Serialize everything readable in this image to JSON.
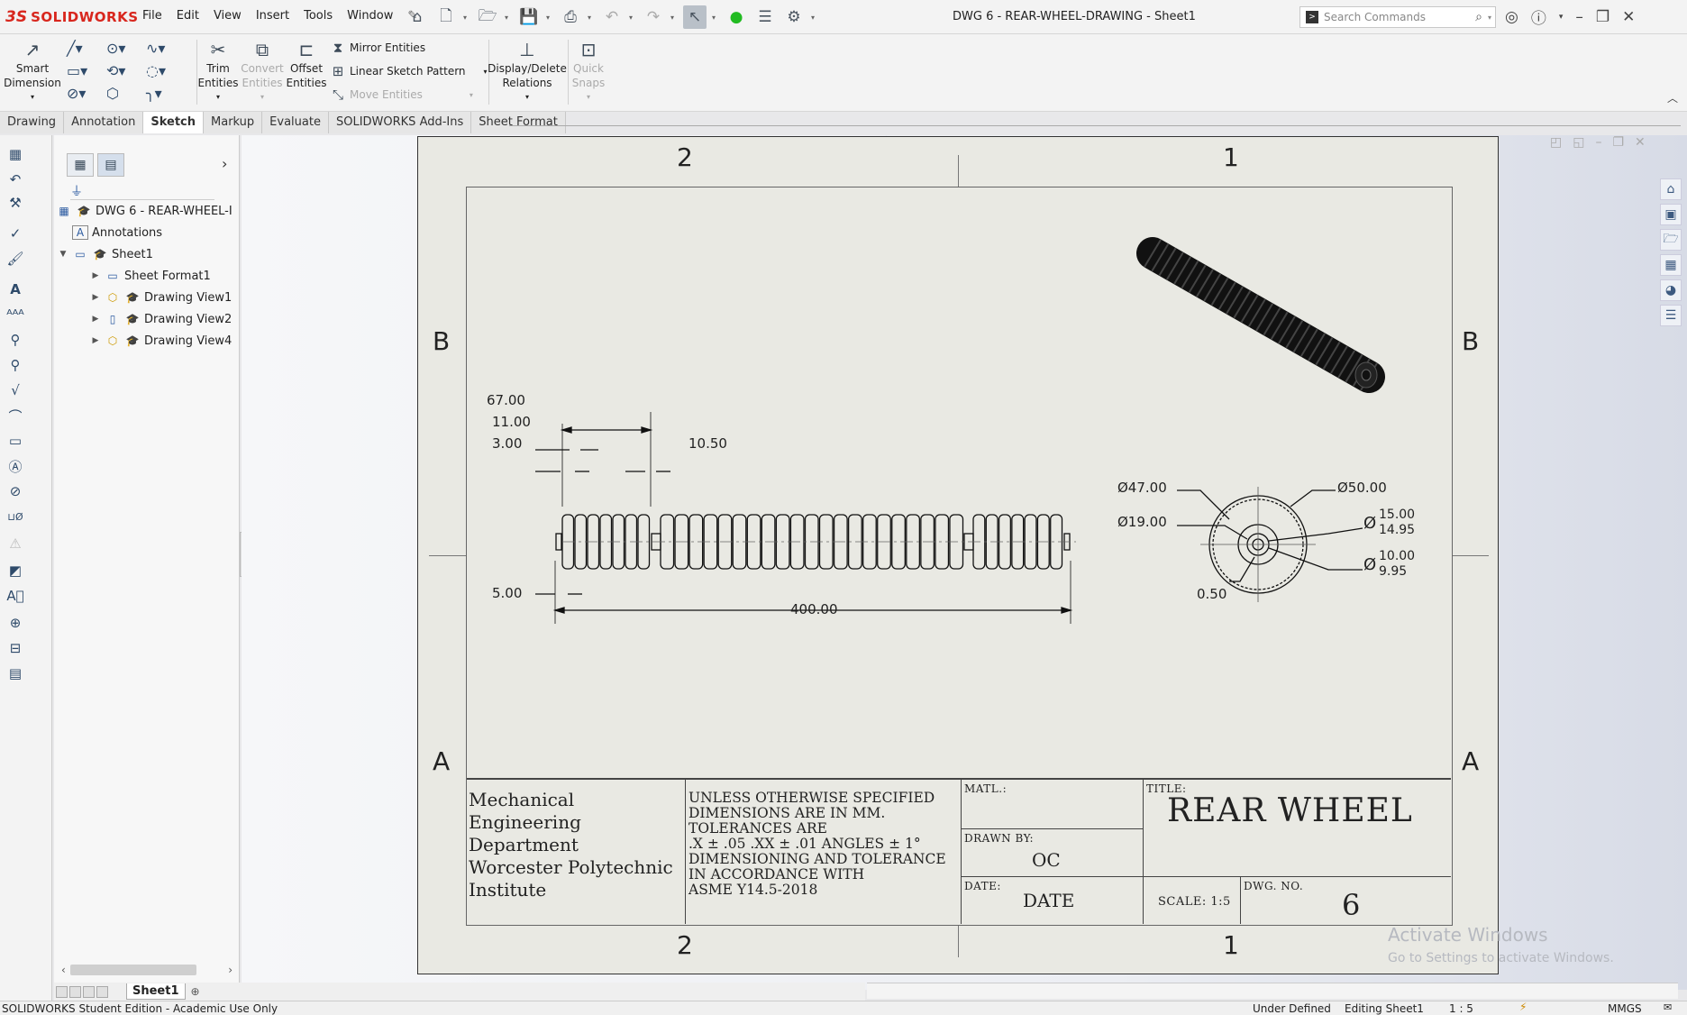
{
  "app": {
    "brand_ds": "3S",
    "brand_name": "SOLIDWORKS",
    "document_title": "DWG 6 - REAR-WHEEL-DRAWING - Sheet1"
  },
  "menu": [
    "File",
    "Edit",
    "View",
    "Insert",
    "Tools",
    "Window"
  ],
  "search": {
    "placeholder": "Search Commands"
  },
  "commands": {
    "smart_dimension": [
      "Smart",
      "Dimension"
    ],
    "trim_entities": [
      "Trim",
      "Entities"
    ],
    "convert_entities": [
      "Convert",
      "Entities"
    ],
    "offset_entities": [
      "Offset",
      "Entities"
    ],
    "mirror_entities": "Mirror Entities",
    "linear_sketch_pattern": "Linear Sketch Pattern",
    "move_entities": "Move Entities",
    "display_delete_relations": [
      "Display/Delete",
      "Relations"
    ],
    "quick_snaps": [
      "Quick",
      "Snaps"
    ]
  },
  "tabs": [
    "Drawing",
    "Annotation",
    "Sketch",
    "Markup",
    "Evaluate",
    "SOLIDWORKS Add-Ins",
    "Sheet Format"
  ],
  "active_tab": "Sketch",
  "tree": {
    "root": "DWG 6 - REAR-WHEEL-I",
    "annotations": "Annotations",
    "sheet": "Sheet1",
    "sheet_format": "Sheet Format1",
    "views": [
      "Drawing View1",
      "Drawing View2",
      "Drawing View4"
    ]
  },
  "sheet": {
    "zones_top": [
      "2",
      "1"
    ],
    "zones_side": [
      "B",
      "A"
    ],
    "dims_front": {
      "d67": "67.00",
      "d11": "11.00",
      "d3": "3.00",
      "d10_5": "10.50",
      "d5": "5.00",
      "d400": "400.00"
    },
    "dims_side": {
      "dia47": "Ø47.00",
      "dia50": "Ø50.00",
      "dia19": "Ø19.00",
      "dia15_up": "15.00",
      "dia15_lo": "14.95",
      "dia15_sym": "Ø",
      "dia10_up": "10.00",
      "dia10_lo": "9.95",
      "dia10_sym": "Ø",
      "d05": "0.50"
    },
    "title_block": {
      "org": [
        "Mechanical Engineering",
        "Department",
        "Worcester Polytechnic",
        "Institute"
      ],
      "notes": [
        "UNLESS OTHERWISE SPECIFIED",
        "DIMENSIONS ARE IN MM.",
        "TOLERANCES ARE",
        ".X ± .05 .XX ± .01 ANGLES ± 1°",
        "DIMENSIONING AND TOLERANCE",
        "IN ACCORDANCE WITH",
        "ASME Y14.5-2018"
      ],
      "matl_label": "MATL.:",
      "drawn_by_label": "DRAWN BY:",
      "drawn_by": "OC",
      "date_label": "DATE:",
      "date": "DATE",
      "title_label": "TITLE:",
      "title": "REAR WHEEL",
      "scale": "SCALE: 1:5",
      "dwg_no_label": "DWG. NO.",
      "dwg_no": "6"
    }
  },
  "sheet_tab": "Sheet1",
  "watermark": {
    "line1": "Activate Windows",
    "line2": "Go to Settings to activate Windows."
  },
  "status": {
    "edition": "SOLIDWORKS Student Edition - Academic Use Only",
    "state": "Under Defined",
    "editing": "Editing Sheet1",
    "scale": "1 : 5",
    "units": "MMGS"
  }
}
